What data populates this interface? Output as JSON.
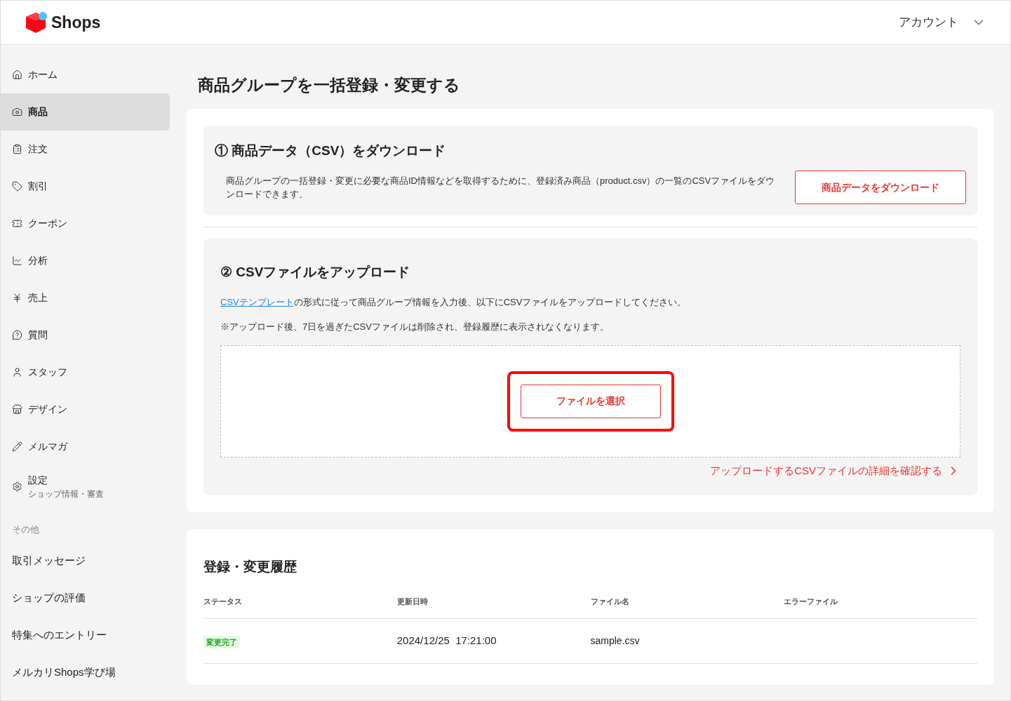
{
  "header": {
    "logo_text": "Shops",
    "account": "アカウント"
  },
  "sidebar": {
    "items": [
      {
        "label": "ホーム",
        "selected": false
      },
      {
        "label": "商品",
        "selected": true
      },
      {
        "label": "注文",
        "selected": false
      },
      {
        "label": "割引",
        "selected": false
      },
      {
        "label": "クーポン",
        "selected": false
      },
      {
        "label": "分析",
        "selected": false
      },
      {
        "label": "売上",
        "selected": false
      },
      {
        "label": "質問",
        "selected": false
      },
      {
        "label": "スタッフ",
        "selected": false
      },
      {
        "label": "デザイン",
        "selected": false
      },
      {
        "label": "メルマガ",
        "selected": false
      },
      {
        "label": "設定",
        "sublabel": "ショップ情報・審査",
        "selected": false
      }
    ],
    "other_heading": "その他",
    "other_items": [
      "取引メッセージ",
      "ショップの評価",
      "特集へのエントリー",
      "メルカリShops学び場"
    ]
  },
  "page_title": "商品グループを一括登録・変更する",
  "download_section": {
    "title": "① 商品データ（CSV）をダウンロード",
    "description": "商品グループの一括登録・変更に必要な商品ID情報などを取得するために、登録済み商品（product.csv）の一覧のCSVファイルをダウンロードできます。",
    "button": "商品データをダウンロード"
  },
  "upload_section": {
    "title": "② CSVファイルをアップロード",
    "template_link": "CSVテンプレート",
    "instruction": "の形式に従って商品グループ情報を入力後、以下にCSVファイルをアップロードしてください。",
    "note": "※アップロード後、7日を過ぎたCSVファイルは削除され、登録履歴に表示されなくなります。",
    "select_button": "ファイルを選択",
    "highlighted": true,
    "details_link": "アップロードするCSVファイルの詳細を確認する"
  },
  "history": {
    "title": "登録・変更履歴",
    "columns": [
      "ステータス",
      "更新日時",
      "ファイル名",
      "エラーファイル"
    ],
    "rows": [
      {
        "status": "変更完了",
        "updated": "2024/12/25  17:21:00",
        "file": "sample.csv"
      }
    ]
  }
}
